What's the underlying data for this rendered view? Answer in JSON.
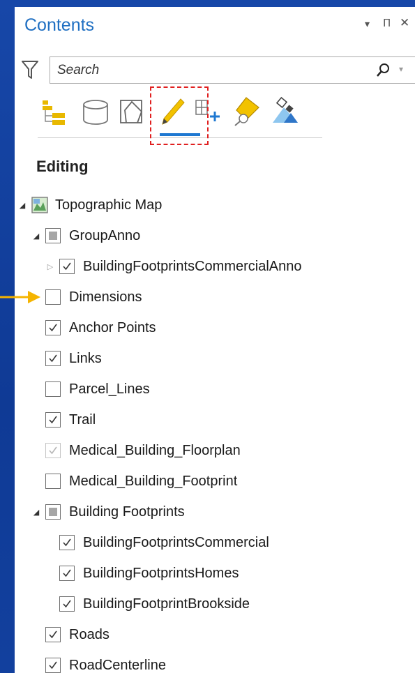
{
  "panel": {
    "title": "Contents",
    "controls": [
      "▾",
      "Π",
      "✕"
    ]
  },
  "search": {
    "placeholder": "Search",
    "value": ""
  },
  "toolbar": {
    "tools": [
      {
        "name": "list-by-drawing-order",
        "icon": "drawing-order-icon"
      },
      {
        "name": "list-by-data-source",
        "icon": "data-source-icon"
      },
      {
        "name": "list-by-selection",
        "icon": "selection-icon"
      },
      {
        "name": "list-by-editing",
        "icon": "pencil-icon",
        "active": true
      },
      {
        "name": "list-by-snapping",
        "icon": "snapping-icon"
      },
      {
        "name": "list-by-labeling",
        "icon": "labeling-icon"
      },
      {
        "name": "list-by-perspective-imagery",
        "icon": "satellite-icon"
      }
    ],
    "active_color": "#1f78d1",
    "highlight_color": "#e02020"
  },
  "section": {
    "title": "Editing"
  },
  "tree": [
    {
      "label": "Topographic Map",
      "level": 0,
      "expander": "expanded",
      "kind": "map"
    },
    {
      "label": "GroupAnno",
      "level": 1,
      "expander": "expanded",
      "kind": "partial"
    },
    {
      "label": "BuildingFootprintsCommercialAnno",
      "level": 2,
      "expander": "collapsed",
      "kind": "checked"
    },
    {
      "label": "Dimensions",
      "level": 1,
      "expander": "none",
      "kind": "unchecked"
    },
    {
      "label": "Anchor Points",
      "level": 1,
      "expander": "none",
      "kind": "checked"
    },
    {
      "label": "Links",
      "level": 1,
      "expander": "none",
      "kind": "checked"
    },
    {
      "label": "Parcel_Lines",
      "level": 1,
      "expander": "none",
      "kind": "unchecked"
    },
    {
      "label": "Trail",
      "level": 1,
      "expander": "none",
      "kind": "checked"
    },
    {
      "label": "Medical_Building_Floorplan",
      "level": 1,
      "expander": "none",
      "kind": "checked-disabled"
    },
    {
      "label": "Medical_Building_Footprint",
      "level": 1,
      "expander": "none",
      "kind": "unchecked"
    },
    {
      "label": "Building Footprints",
      "level": 1,
      "expander": "expanded",
      "kind": "partial"
    },
    {
      "label": "BuildingFootprintsCommercial",
      "level": 2,
      "expander": "none",
      "kind": "checked"
    },
    {
      "label": "BuildingFootprintsHomes",
      "level": 2,
      "expander": "none",
      "kind": "checked"
    },
    {
      "label": "BuildingFootprintBrookside",
      "level": 2,
      "expander": "none",
      "kind": "checked"
    },
    {
      "label": "Roads",
      "level": 1,
      "expander": "none",
      "kind": "checked"
    },
    {
      "label": "RoadCenterline",
      "level": 1,
      "expander": "none",
      "kind": "checked"
    }
  ],
  "callout": {
    "target": "Dimensions",
    "icon": "arrow-right-icon",
    "color": "#f5b400"
  }
}
